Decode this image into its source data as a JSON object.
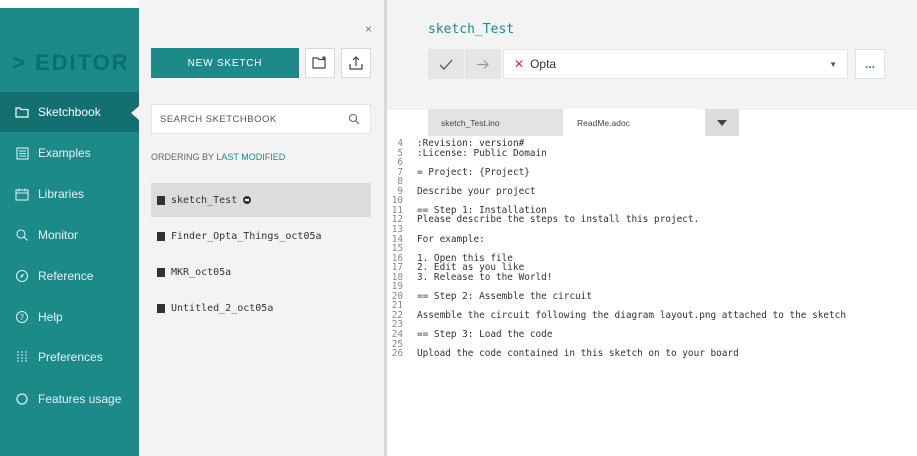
{
  "sidebar": {
    "brand": "> EDITOR",
    "items": [
      {
        "label": "Sketchbook",
        "icon": "folder-icon"
      },
      {
        "label": "Examples",
        "icon": "list-icon"
      },
      {
        "label": "Libraries",
        "icon": "library-icon"
      },
      {
        "label": "Monitor",
        "icon": "monitor-icon"
      },
      {
        "label": "Reference",
        "icon": "compass-icon"
      },
      {
        "label": "Help",
        "icon": "help-icon"
      },
      {
        "label": "Preferences",
        "icon": "sliders-icon"
      },
      {
        "label": "Features usage",
        "icon": "circle-icon"
      }
    ]
  },
  "sketchbook": {
    "close": "×",
    "new_sketch": "NEW SKETCH",
    "search_placeholder": "SEARCH SKETCHBOOK",
    "ordering_prefix": "ORDERING BY",
    "ordering_value": "LAST MODIFIED",
    "items": [
      "sketch_Test",
      "Finder_Opta_Things_oct05a",
      "MKR_oct05a",
      "Untitled_2_oct05a"
    ]
  },
  "editor": {
    "title": "sketch_Test",
    "board": "Opta",
    "more": "...",
    "tabs": [
      "sketch_Test.ino",
      "ReadMe.adoc"
    ],
    "lines": [
      {
        "n": "4",
        "t": ":Revision: version#"
      },
      {
        "n": "5",
        "t": ":License: Public Domain"
      },
      {
        "n": "6",
        "t": ""
      },
      {
        "n": "7",
        "t": "= Project: {Project}"
      },
      {
        "n": "8",
        "t": ""
      },
      {
        "n": "9",
        "t": "Describe your project"
      },
      {
        "n": "10",
        "t": ""
      },
      {
        "n": "11",
        "t": "== Step 1: Installation"
      },
      {
        "n": "12",
        "t": "Please describe the steps to install this project."
      },
      {
        "n": "13",
        "t": ""
      },
      {
        "n": "14",
        "t": "For example:"
      },
      {
        "n": "15",
        "t": ""
      },
      {
        "n": "16",
        "t": "1. Open this file"
      },
      {
        "n": "17",
        "t": "2. Edit as you like"
      },
      {
        "n": "18",
        "t": "3. Release to the World!"
      },
      {
        "n": "19",
        "t": ""
      },
      {
        "n": "20",
        "t": "== Step 2: Assemble the circuit"
      },
      {
        "n": "21",
        "t": ""
      },
      {
        "n": "22",
        "t": "Assemble the circuit following the diagram layout.png attached to the sketch"
      },
      {
        "n": "23",
        "t": ""
      },
      {
        "n": "24",
        "t": "== Step 3: Load the code"
      },
      {
        "n": "25",
        "t": ""
      },
      {
        "n": "26",
        "t": "Upload the code contained in this sketch on to your board"
      }
    ]
  },
  "colors": {
    "accent": "#1d8a8a",
    "error": "#e03030"
  }
}
